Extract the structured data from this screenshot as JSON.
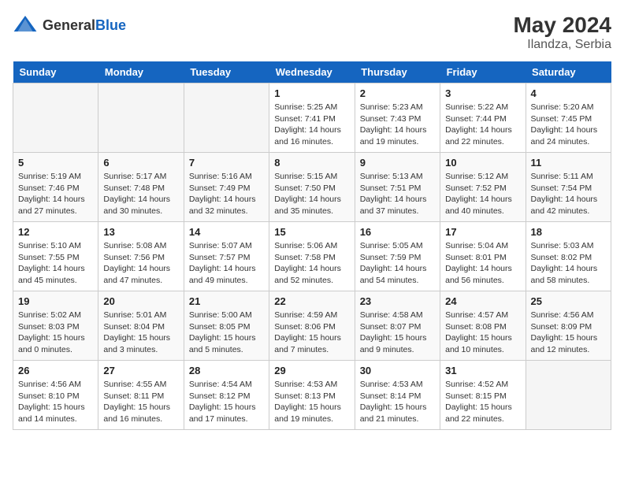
{
  "header": {
    "logo_general": "General",
    "logo_blue": "Blue",
    "month_year": "May 2024",
    "location": "Ilandza, Serbia"
  },
  "days_of_week": [
    "Sunday",
    "Monday",
    "Tuesday",
    "Wednesday",
    "Thursday",
    "Friday",
    "Saturday"
  ],
  "weeks": [
    [
      {
        "day": "",
        "empty": true
      },
      {
        "day": "",
        "empty": true
      },
      {
        "day": "",
        "empty": true
      },
      {
        "day": "1",
        "sunrise": "5:25 AM",
        "sunset": "7:41 PM",
        "daylight": "14 hours and 16 minutes."
      },
      {
        "day": "2",
        "sunrise": "5:23 AM",
        "sunset": "7:43 PM",
        "daylight": "14 hours and 19 minutes."
      },
      {
        "day": "3",
        "sunrise": "5:22 AM",
        "sunset": "7:44 PM",
        "daylight": "14 hours and 22 minutes."
      },
      {
        "day": "4",
        "sunrise": "5:20 AM",
        "sunset": "7:45 PM",
        "daylight": "14 hours and 24 minutes."
      }
    ],
    [
      {
        "day": "5",
        "sunrise": "5:19 AM",
        "sunset": "7:46 PM",
        "daylight": "14 hours and 27 minutes."
      },
      {
        "day": "6",
        "sunrise": "5:17 AM",
        "sunset": "7:48 PM",
        "daylight": "14 hours and 30 minutes."
      },
      {
        "day": "7",
        "sunrise": "5:16 AM",
        "sunset": "7:49 PM",
        "daylight": "14 hours and 32 minutes."
      },
      {
        "day": "8",
        "sunrise": "5:15 AM",
        "sunset": "7:50 PM",
        "daylight": "14 hours and 35 minutes."
      },
      {
        "day": "9",
        "sunrise": "5:13 AM",
        "sunset": "7:51 PM",
        "daylight": "14 hours and 37 minutes."
      },
      {
        "day": "10",
        "sunrise": "5:12 AM",
        "sunset": "7:52 PM",
        "daylight": "14 hours and 40 minutes."
      },
      {
        "day": "11",
        "sunrise": "5:11 AM",
        "sunset": "7:54 PM",
        "daylight": "14 hours and 42 minutes."
      }
    ],
    [
      {
        "day": "12",
        "sunrise": "5:10 AM",
        "sunset": "7:55 PM",
        "daylight": "14 hours and 45 minutes."
      },
      {
        "day": "13",
        "sunrise": "5:08 AM",
        "sunset": "7:56 PM",
        "daylight": "14 hours and 47 minutes."
      },
      {
        "day": "14",
        "sunrise": "5:07 AM",
        "sunset": "7:57 PM",
        "daylight": "14 hours and 49 minutes."
      },
      {
        "day": "15",
        "sunrise": "5:06 AM",
        "sunset": "7:58 PM",
        "daylight": "14 hours and 52 minutes."
      },
      {
        "day": "16",
        "sunrise": "5:05 AM",
        "sunset": "7:59 PM",
        "daylight": "14 hours and 54 minutes."
      },
      {
        "day": "17",
        "sunrise": "5:04 AM",
        "sunset": "8:01 PM",
        "daylight": "14 hours and 56 minutes."
      },
      {
        "day": "18",
        "sunrise": "5:03 AM",
        "sunset": "8:02 PM",
        "daylight": "14 hours and 58 minutes."
      }
    ],
    [
      {
        "day": "19",
        "sunrise": "5:02 AM",
        "sunset": "8:03 PM",
        "daylight": "15 hours and 0 minutes."
      },
      {
        "day": "20",
        "sunrise": "5:01 AM",
        "sunset": "8:04 PM",
        "daylight": "15 hours and 3 minutes."
      },
      {
        "day": "21",
        "sunrise": "5:00 AM",
        "sunset": "8:05 PM",
        "daylight": "15 hours and 5 minutes."
      },
      {
        "day": "22",
        "sunrise": "4:59 AM",
        "sunset": "8:06 PM",
        "daylight": "15 hours and 7 minutes."
      },
      {
        "day": "23",
        "sunrise": "4:58 AM",
        "sunset": "8:07 PM",
        "daylight": "15 hours and 9 minutes."
      },
      {
        "day": "24",
        "sunrise": "4:57 AM",
        "sunset": "8:08 PM",
        "daylight": "15 hours and 10 minutes."
      },
      {
        "day": "25",
        "sunrise": "4:56 AM",
        "sunset": "8:09 PM",
        "daylight": "15 hours and 12 minutes."
      }
    ],
    [
      {
        "day": "26",
        "sunrise": "4:56 AM",
        "sunset": "8:10 PM",
        "daylight": "15 hours and 14 minutes."
      },
      {
        "day": "27",
        "sunrise": "4:55 AM",
        "sunset": "8:11 PM",
        "daylight": "15 hours and 16 minutes."
      },
      {
        "day": "28",
        "sunrise": "4:54 AM",
        "sunset": "8:12 PM",
        "daylight": "15 hours and 17 minutes."
      },
      {
        "day": "29",
        "sunrise": "4:53 AM",
        "sunset": "8:13 PM",
        "daylight": "15 hours and 19 minutes."
      },
      {
        "day": "30",
        "sunrise": "4:53 AM",
        "sunset": "8:14 PM",
        "daylight": "15 hours and 21 minutes."
      },
      {
        "day": "31",
        "sunrise": "4:52 AM",
        "sunset": "8:15 PM",
        "daylight": "15 hours and 22 minutes."
      },
      {
        "day": "",
        "empty": true
      }
    ]
  ]
}
